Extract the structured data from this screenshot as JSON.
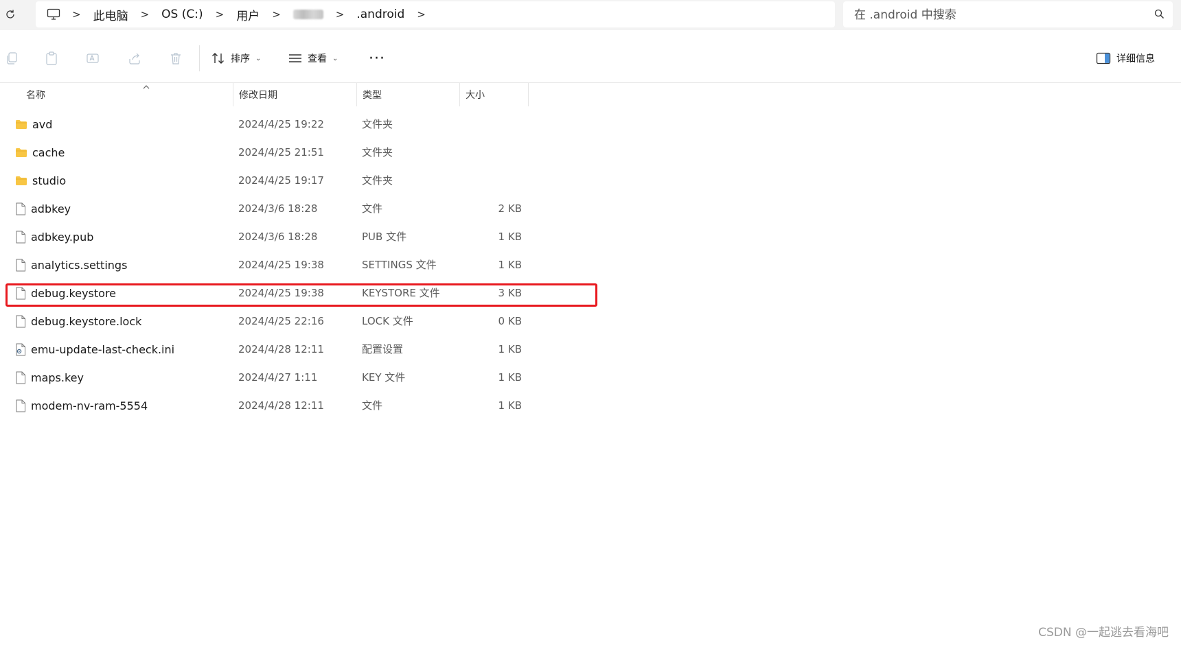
{
  "address_bar": {
    "crumbs": [
      "此电脑",
      "OS (C:)",
      "用户",
      "",
      ".android"
    ],
    "separator": ">"
  },
  "search": {
    "placeholder": "在 .android 中搜索"
  },
  "toolbar": {
    "sort_label": "排序",
    "view_label": "查看",
    "more_label": "···",
    "details_label": "详细信息",
    "dropdown_chevron": "⌄"
  },
  "columns": {
    "name": "名称",
    "date": "修改日期",
    "type": "类型",
    "size": "大小"
  },
  "files": [
    {
      "name": "avd",
      "date": "2024/4/25 19:22",
      "type": "文件夹",
      "size": "",
      "icon": "folder-icon"
    },
    {
      "name": "cache",
      "date": "2024/4/25 21:51",
      "type": "文件夹",
      "size": "",
      "icon": "folder-icon"
    },
    {
      "name": "studio",
      "date": "2024/4/25 19:17",
      "type": "文件夹",
      "size": "",
      "icon": "folder-icon"
    },
    {
      "name": "adbkey",
      "date": "2024/3/6 18:28",
      "type": "文件",
      "size": "2 KB",
      "icon": "file-icon"
    },
    {
      "name": "adbkey.pub",
      "date": "2024/3/6 18:28",
      "type": "PUB 文件",
      "size": "1 KB",
      "icon": "file-icon"
    },
    {
      "name": "analytics.settings",
      "date": "2024/4/25 19:38",
      "type": "SETTINGS 文件",
      "size": "1 KB",
      "icon": "file-icon"
    },
    {
      "name": "debug.keystore",
      "date": "2024/4/25 19:38",
      "type": "KEYSTORE 文件",
      "size": "3 KB",
      "icon": "file-icon"
    },
    {
      "name": "debug.keystore.lock",
      "date": "2024/4/25 22:16",
      "type": "LOCK 文件",
      "size": "0 KB",
      "icon": "file-icon"
    },
    {
      "name": "emu-update-last-check.ini",
      "date": "2024/4/28 12:11",
      "type": "配置设置",
      "size": "1 KB",
      "icon": "settings-file-icon"
    },
    {
      "name": "maps.key",
      "date": "2024/4/27 1:11",
      "type": "KEY 文件",
      "size": "1 KB",
      "icon": "file-icon"
    },
    {
      "name": "modem-nv-ram-5554",
      "date": "2024/4/28 12:11",
      "type": "文件",
      "size": "1 KB",
      "icon": "file-icon"
    }
  ],
  "highlighted_file": "debug.keystore",
  "highlight_color": "#e8181e",
  "folder_color": "#f8c644",
  "watermark": "CSDN @一起逃去看海吧"
}
